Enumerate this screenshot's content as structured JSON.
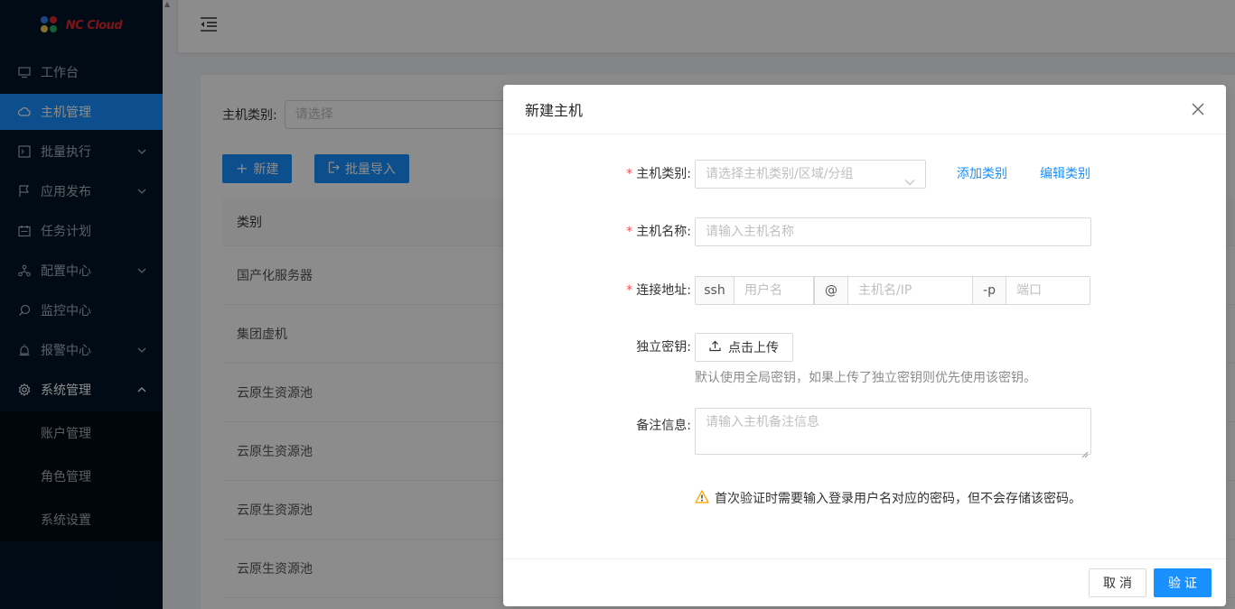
{
  "brand": {
    "logo_text": "NC Cloud"
  },
  "sidebar": {
    "items": [
      {
        "label": "工作台",
        "icon": "desktop-icon"
      },
      {
        "label": "主机管理",
        "icon": "cloud-icon",
        "active": true
      },
      {
        "label": "批量执行",
        "icon": "code-icon",
        "arrow": "down"
      },
      {
        "label": "应用发布",
        "icon": "flag-icon",
        "arrow": "down"
      },
      {
        "label": "任务计划",
        "icon": "schedule-icon"
      },
      {
        "label": "配置中心",
        "icon": "deployment-icon",
        "arrow": "down"
      },
      {
        "label": "监控中心",
        "icon": "monitor-icon"
      },
      {
        "label": "报警中心",
        "icon": "alert-icon",
        "arrow": "down"
      },
      {
        "label": "系统管理",
        "icon": "setting-icon",
        "arrow": "up"
      }
    ],
    "sub_items": [
      {
        "label": "账户管理"
      },
      {
        "label": "角色管理"
      },
      {
        "label": "系统设置"
      }
    ]
  },
  "page": {
    "filter_label": "主机类别:",
    "filter_placeholder": "请选择",
    "new_button": "新建",
    "import_button": "批量导入",
    "table_header": "类别",
    "rows": [
      "国产化服务器",
      "集团虚机",
      "云原生资源池",
      "云原生资源池",
      "云原生资源池",
      "云原生资源池"
    ]
  },
  "modal": {
    "title": "新建主机",
    "fields": {
      "category_label": "主机类别",
      "category_placeholder": "请选择主机类别/区域/分组",
      "add_category": "添加类别",
      "edit_category": "编辑类别",
      "name_label": "主机名称",
      "name_placeholder": "请输入主机名称",
      "address_label": "连接地址",
      "ssh_addon": "ssh",
      "username_placeholder": "用户名",
      "at_addon": "@",
      "hostname_placeholder": "主机名/IP",
      "port_addon": "-p",
      "port_placeholder": "端口",
      "key_label": "独立密钥",
      "upload_button": "点击上传",
      "key_help": "默认使用全局密钥，如果上传了独立密钥则优先使用该密钥。",
      "remark_label": "备注信息",
      "remark_placeholder": "请输入主机备注信息",
      "warning_text": "首次验证时需要输入登录用户名对应的密码，但不会存储该密码。"
    },
    "cancel_button": "取消",
    "ok_button": "验证"
  },
  "colors": {
    "primary": "#1890ff",
    "sidebar_bg": "#001529",
    "required": "#ff4d4f",
    "warning": "#faad14"
  }
}
